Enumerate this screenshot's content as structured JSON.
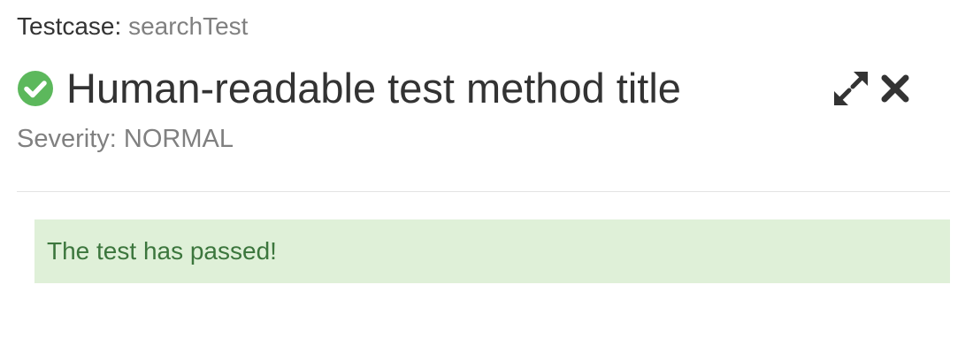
{
  "testcase": {
    "label": "Testcase:",
    "name": "searchTest"
  },
  "header": {
    "status_icon": "check-circle-icon",
    "status_color": "#5cb85c",
    "title": "Human-readable test method title"
  },
  "controls": {
    "expand_icon": "expand-icon",
    "close_icon": "close-icon"
  },
  "severity": {
    "text": "Severity: NORMAL"
  },
  "status_message": {
    "text": "The test has passed!",
    "background": "#dff0d8",
    "color": "#3c763d"
  }
}
